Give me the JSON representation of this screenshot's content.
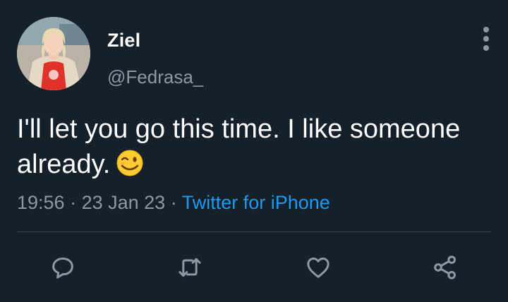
{
  "user": {
    "display_name": "Ziel",
    "handle": "@Fedrasa_"
  },
  "tweet": {
    "text": "I'll let you go this time. I like someone already.",
    "emoji": "winking-face"
  },
  "meta": {
    "time": "19:56",
    "separator": " · ",
    "date": "23 Jan 23",
    "source": "Twitter for iPhone"
  },
  "actions": [
    "reply-icon",
    "retweet-icon",
    "like-icon",
    "share-icon"
  ],
  "colors": {
    "background": "#15202b",
    "text": "#ffffff",
    "secondary": "#8b98a5",
    "link": "#1d9bf0",
    "divider": "#38444d"
  }
}
